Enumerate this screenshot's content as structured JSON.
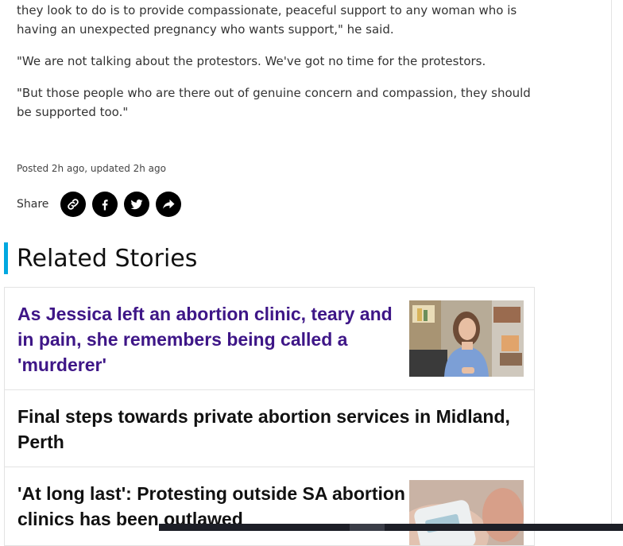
{
  "article": {
    "paragraphs": [
      "they look to do is to provide compassionate, peaceful support to any woman who is having an unexpected pregnancy who wants support,\" he said.",
      "\"We are not talking about the protestors. We've got no time for the protestors.",
      "\"But those people who are there out of genuine concern and compassion, they should be supported too.\""
    ],
    "meta": "Posted 2h ago, updated 2h ago"
  },
  "share": {
    "label": "Share",
    "buttons": [
      "link-icon",
      "facebook-icon",
      "twitter-icon",
      "share-arrow-icon"
    ]
  },
  "related": {
    "title": "Related Stories",
    "accent_color": "#00a8e0",
    "visited_link_color": "#3e1687",
    "stories": [
      {
        "title": "As Jessica left an abortion clinic, teary and in pain, she remembers being called a 'murderer'",
        "visited": true
      },
      {
        "title": "Final steps towards private abortion services in Midland, Perth",
        "visited": false
      },
      {
        "title": "'At long last': Protesting outside SA abortion clinics has been outlawed",
        "visited": false
      }
    ]
  }
}
